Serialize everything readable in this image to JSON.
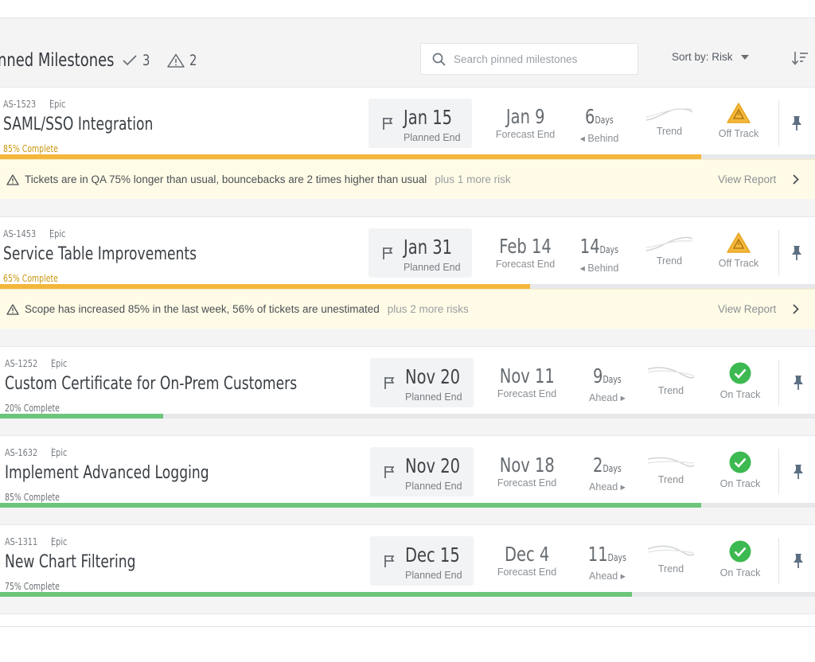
{
  "header": {
    "title": "inned Milestones",
    "done_count": "3",
    "warn_count": "2",
    "search_placeholder": "Search pinned milestones",
    "sort_label": "Sort by: Risk"
  },
  "colors": {
    "warn": "#f4b73c",
    "ok": "#6cc57a",
    "warn_text": "#c9970c",
    "risk_bg": "#fffbe6"
  },
  "milestones": [
    {
      "key": "AS-1523",
      "type": "Epic",
      "name": "SAML/SSO Integration",
      "progress_label": "85% Complete",
      "progress": 0.86,
      "planned_date": "Jan 15",
      "planned_label": "Planned End",
      "forecast_date": "Jan 9",
      "forecast_label": "Forecast End",
      "days_num": "6",
      "days_unit": "Days",
      "days_dir": "Behind",
      "trend_label": "Trend",
      "status_label": "Off Track",
      "status": "off",
      "risk_text": "Tickets are in QA 75% longer than usual, bouncebacks are 2 times higher than usual",
      "risk_more": "plus 1 more risk",
      "view_report": "View Report"
    },
    {
      "key": "AS-1453",
      "type": "Epic",
      "name": "Service Table Improvements",
      "progress_label": "65% Complete",
      "progress": 0.65,
      "planned_date": "Jan 31",
      "planned_label": "Planned End",
      "forecast_date": "Feb 14",
      "forecast_label": "Forecast End",
      "days_num": "14",
      "days_unit": "Days",
      "days_dir": "Behind",
      "trend_label": "Trend",
      "status_label": "Off Track",
      "status": "off",
      "risk_text": "Scope has increased 85% in the last week, 56% of tickets are unestimated",
      "risk_more": "plus 2 more risks",
      "view_report": "View Report"
    },
    {
      "key": "AS-1252",
      "type": "Epic",
      "name": "Custom Certificate for On-Prem Customers",
      "progress_label": "20% Complete",
      "progress": 0.2,
      "planned_date": "Nov 20",
      "planned_label": "Planned End",
      "forecast_date": "Nov 11",
      "forecast_label": "Forecast End",
      "days_num": "9",
      "days_unit": "Days",
      "days_dir": "Ahead",
      "trend_label": "Trend",
      "status_label": "On Track",
      "status": "on"
    },
    {
      "key": "AS-1632",
      "type": "Epic",
      "name": "Implement Advanced Logging",
      "progress_label": "85% Complete",
      "progress": 0.86,
      "planned_date": "Nov 20",
      "planned_label": "Planned End",
      "forecast_date": "Nov 18",
      "forecast_label": "Forecast End",
      "days_num": "2",
      "days_unit": "Days",
      "days_dir": "Ahead",
      "trend_label": "Trend",
      "status_label": "On Track",
      "status": "on"
    },
    {
      "key": "AS-1311",
      "type": "Epic",
      "name": "New Chart Filtering",
      "progress_label": "75% Complete",
      "progress": 0.775,
      "planned_date": "Dec 15",
      "planned_label": "Planned End",
      "forecast_date": "Dec 4",
      "forecast_label": "Forecast End",
      "days_num": "11",
      "days_unit": "Days",
      "days_dir": "Ahead",
      "trend_label": "Trend",
      "status_label": "On Track",
      "status": "on"
    }
  ]
}
